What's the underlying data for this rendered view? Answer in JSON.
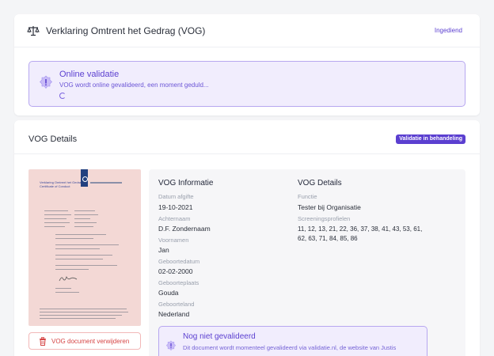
{
  "header": {
    "title": "Verklaring Omtrent het Gedrag (VOG)",
    "status": "Ingediend",
    "icon": "scale-icon"
  },
  "validation": {
    "title": "Online validatie",
    "message": "VOG wordt online gevalideerd, een moment geduld...",
    "icon": "badge-info-icon"
  },
  "details": {
    "title": "VOG Details",
    "badge": "Validatie in behandeling",
    "delete_button": "VOG document verwijderen",
    "document_preview": {
      "heading": "Verklaring Omtrent het Gedrag Certificate of Conduct"
    },
    "info": {
      "heading": "VOG Informatie",
      "fields": [
        {
          "label": "Datum afgifte",
          "value": "19-10-2021"
        },
        {
          "label": "Achternaam",
          "value": "D.F. Zondernaam"
        },
        {
          "label": "Voornamen",
          "value": "Jan"
        },
        {
          "label": "Geboortedatum",
          "value": "02-02-2000"
        },
        {
          "label": "Geboorteplaats",
          "value": "Gouda"
        },
        {
          "label": "Geboorteland",
          "value": "Nederland"
        }
      ]
    },
    "vog": {
      "heading": "VOG Details",
      "function_label": "Functie",
      "function_value": "Tester bij Organisatie",
      "profiles_label": "Screeningsprofielen",
      "profiles_value": "11, 12, 13, 21, 22, 36, 37, 38, 41, 43, 53, 61, 62, 63, 71, 84, 85, 86"
    },
    "not_validated": {
      "title": "Nog niet gevalideerd",
      "message": "Dit document wordt momenteel gevalideerd via validatie.nl, de website van Justis"
    }
  },
  "colors": {
    "accent": "#5b3fd0",
    "info_bg": "#f1edfd",
    "danger": "#d64545",
    "doc_bg": "#f3d8d5"
  }
}
